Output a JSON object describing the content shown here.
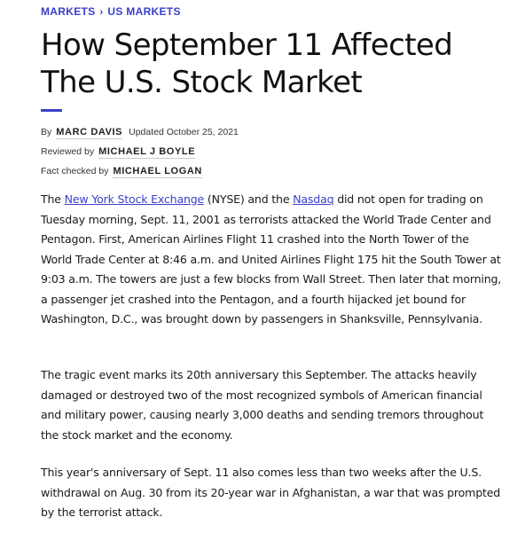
{
  "breadcrumb": {
    "items": [
      "MARKETS",
      "US MARKETS"
    ],
    "separator": "›"
  },
  "article": {
    "title": "How September 11 Affected The U.S. Stock Market",
    "byline": {
      "by_label": "By",
      "author": "MARC DAVIS",
      "updated": "Updated October 25, 2021",
      "reviewed_label": "Reviewed by",
      "reviewer": "MICHAEL J BOYLE",
      "factcheck_label": "Fact checked by",
      "factchecker": "MICHAEL LOGAN"
    },
    "p1": {
      "t0": "The ",
      "link1": "New York Stock Exchange",
      "t1": " (NYSE) and the ",
      "link2": "Nasdaq",
      "t2": " did not open for trading on Tuesday morning, Sept. 11, 2001 as terrorists attacked the World Trade Center and Pentagon. First, American Airlines Flight 11 crashed into the North Tower of the World Trade Center at 8:46 a.m. and United Airlines Flight 175 hit the South Tower at 9:03 a.m. The towers are just a few blocks from Wall Street. Then later that morning, a passenger jet crashed into the Pentagon, and a fourth hijacked jet bound for Washington, D.C., was brought down by passengers in Shanksville, Pennsylvania."
    },
    "p2": "The tragic event marks its 20th anniversary this September. The attacks heavily damaged or destroyed two of the most recognized symbols of American financial and military power, causing nearly 3,000 deaths and sending tremors throughout the stock market and the economy.",
    "p3": "This year's anniversary of Sept. 11 also comes less than two weeks after the U.S. withdrawal on Aug. 30 from its 20-year war in Afghanistan, a war that was prompted by the terrorist attack."
  },
  "colors": {
    "accent": "#3b3fc9",
    "text": "#1a1a1a"
  }
}
